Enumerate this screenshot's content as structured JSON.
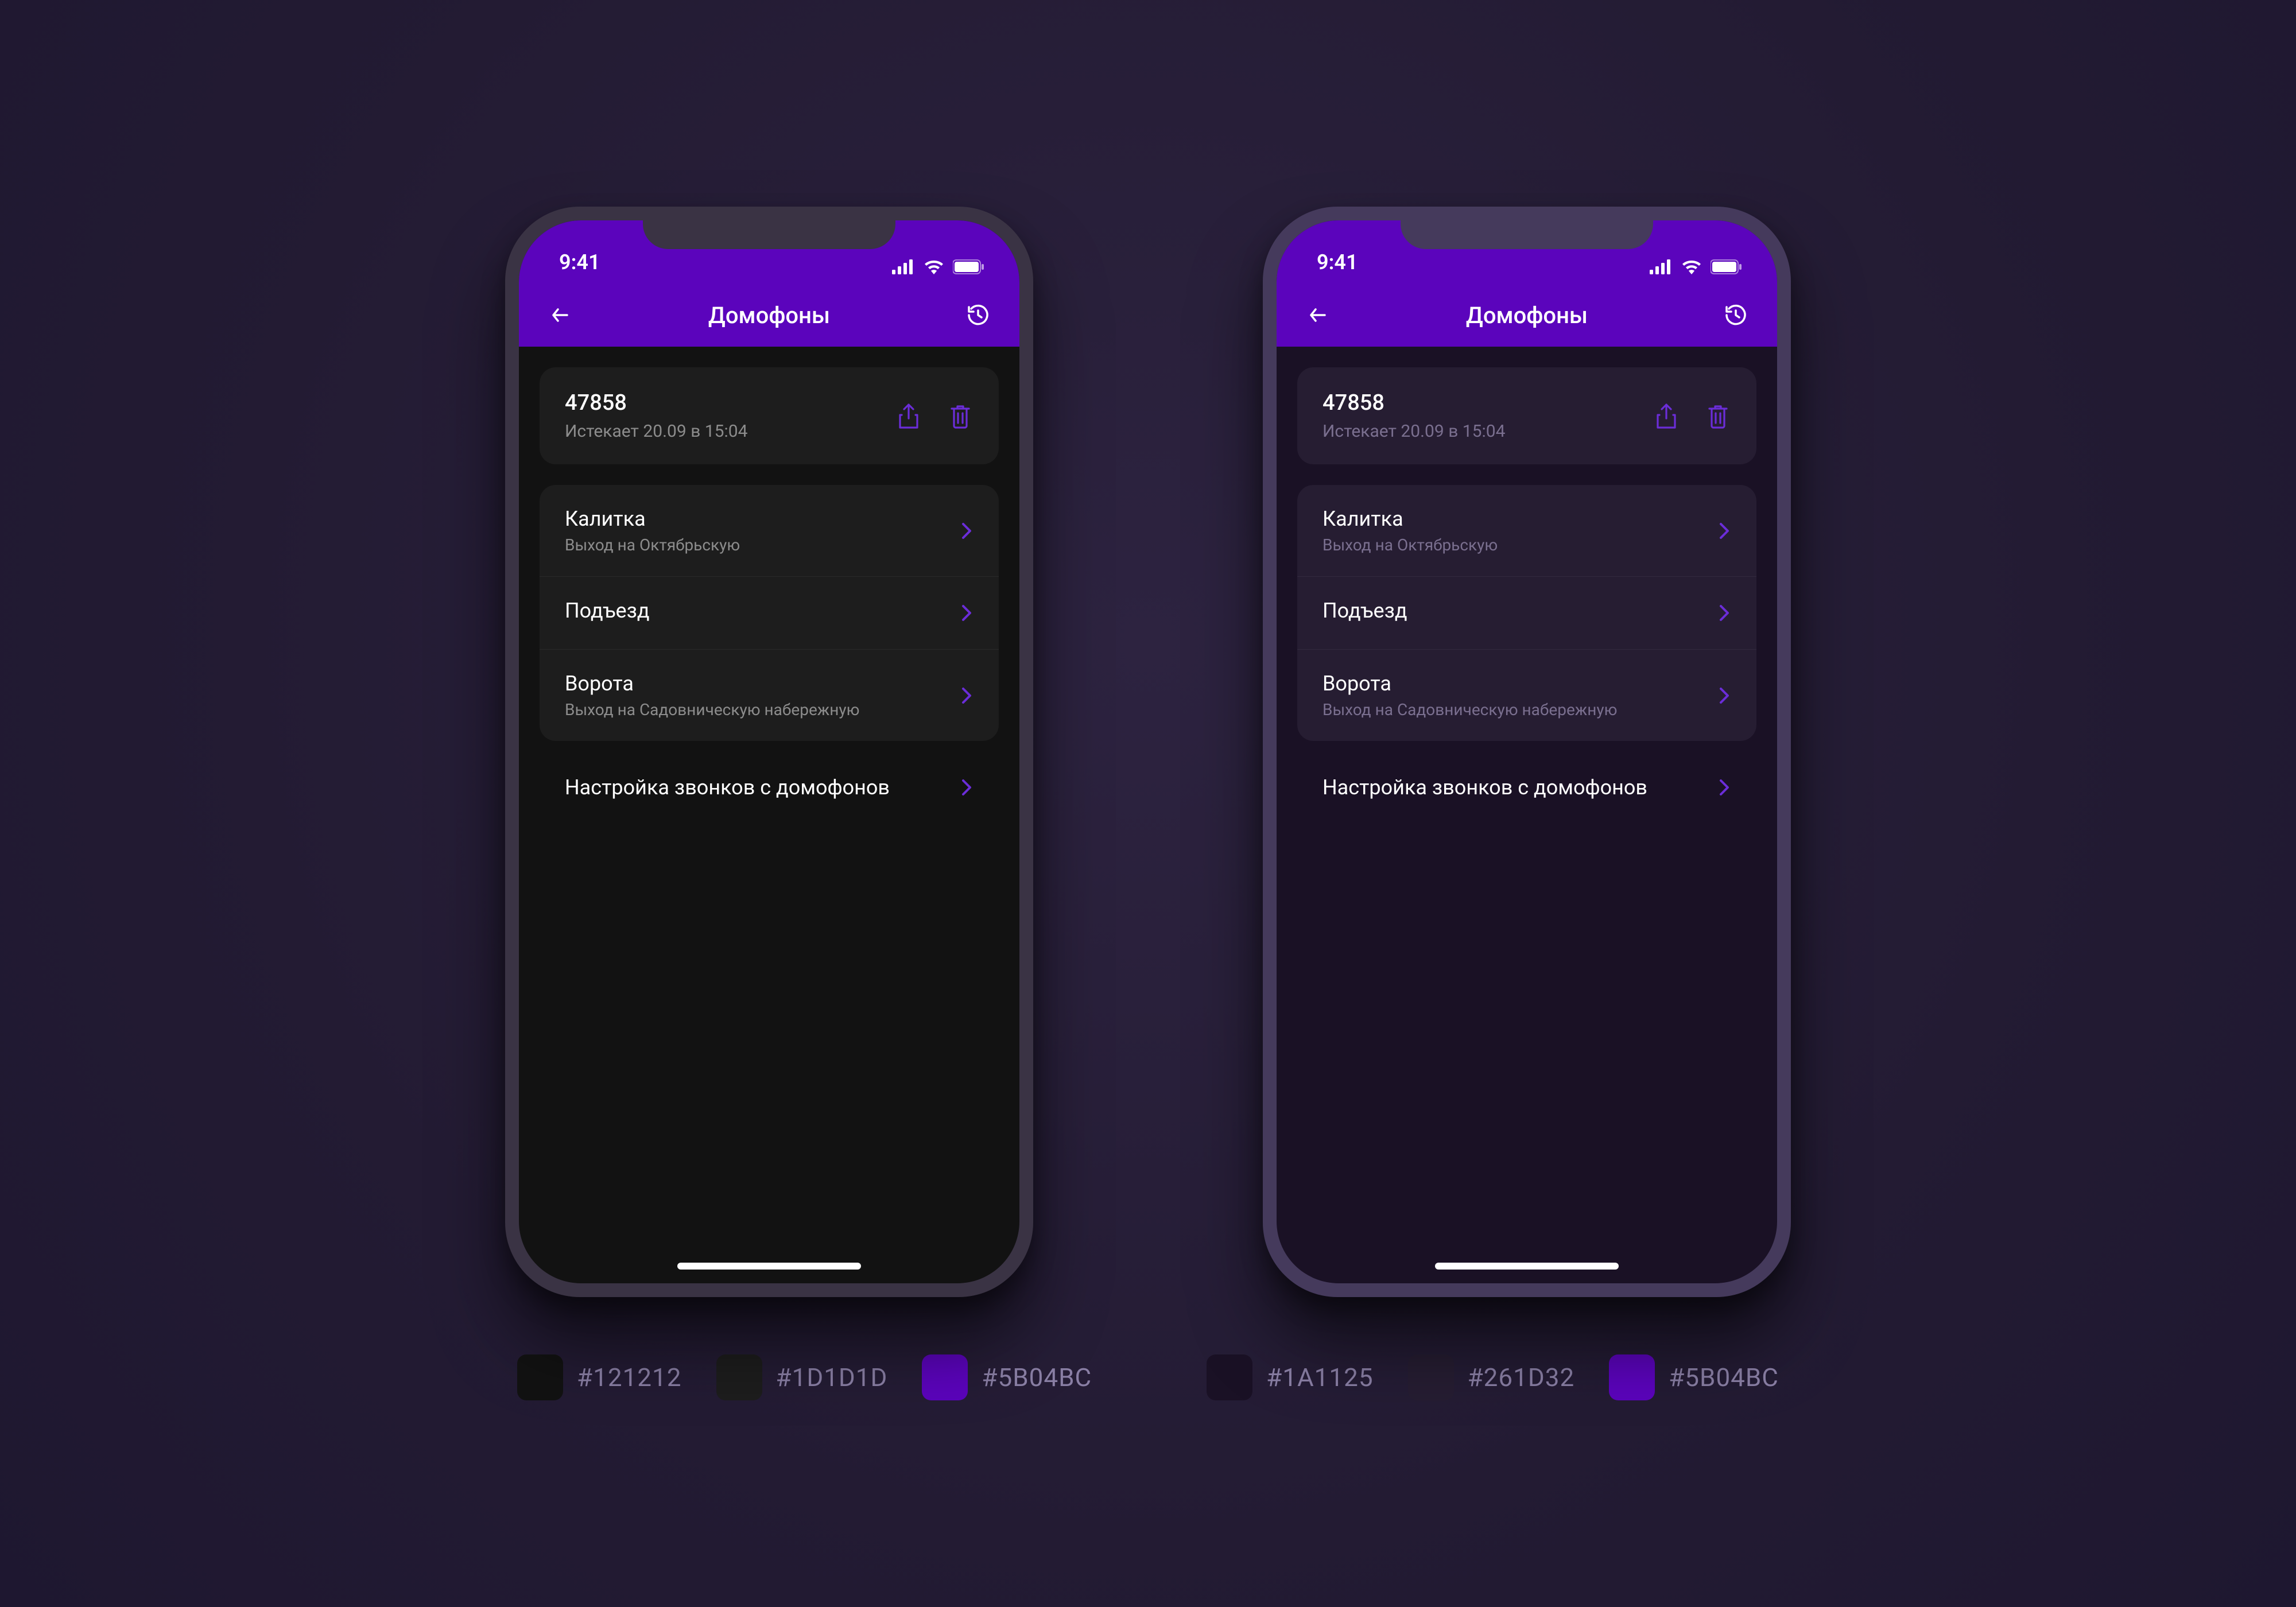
{
  "status": {
    "time": "9:41"
  },
  "nav": {
    "title": "Домофоны"
  },
  "key_card": {
    "code": "47858",
    "expiry": "Истекает 20.09 в 15:04"
  },
  "doors": [
    {
      "title": "Калитка",
      "sub": "Выход на Октябрьскую"
    },
    {
      "title": "Подъезд",
      "sub": ""
    },
    {
      "title": "Ворота",
      "sub": "Выход на Садовническую набережную"
    }
  ],
  "settings_link": "Настройка звонков с домофонов",
  "palettes": {
    "left": [
      {
        "color": "#121212",
        "label": "#121212"
      },
      {
        "color": "#1D1D1D",
        "label": "#1D1D1D"
      },
      {
        "color": "#5B04BC",
        "label": "#5B04BC"
      }
    ],
    "right": [
      {
        "color": "#1A1125",
        "label": "#1A1125"
      },
      {
        "color": "#261D32",
        "label": "#261D32"
      },
      {
        "color": "#5B04BC",
        "label": "#5B04BC"
      }
    ]
  }
}
